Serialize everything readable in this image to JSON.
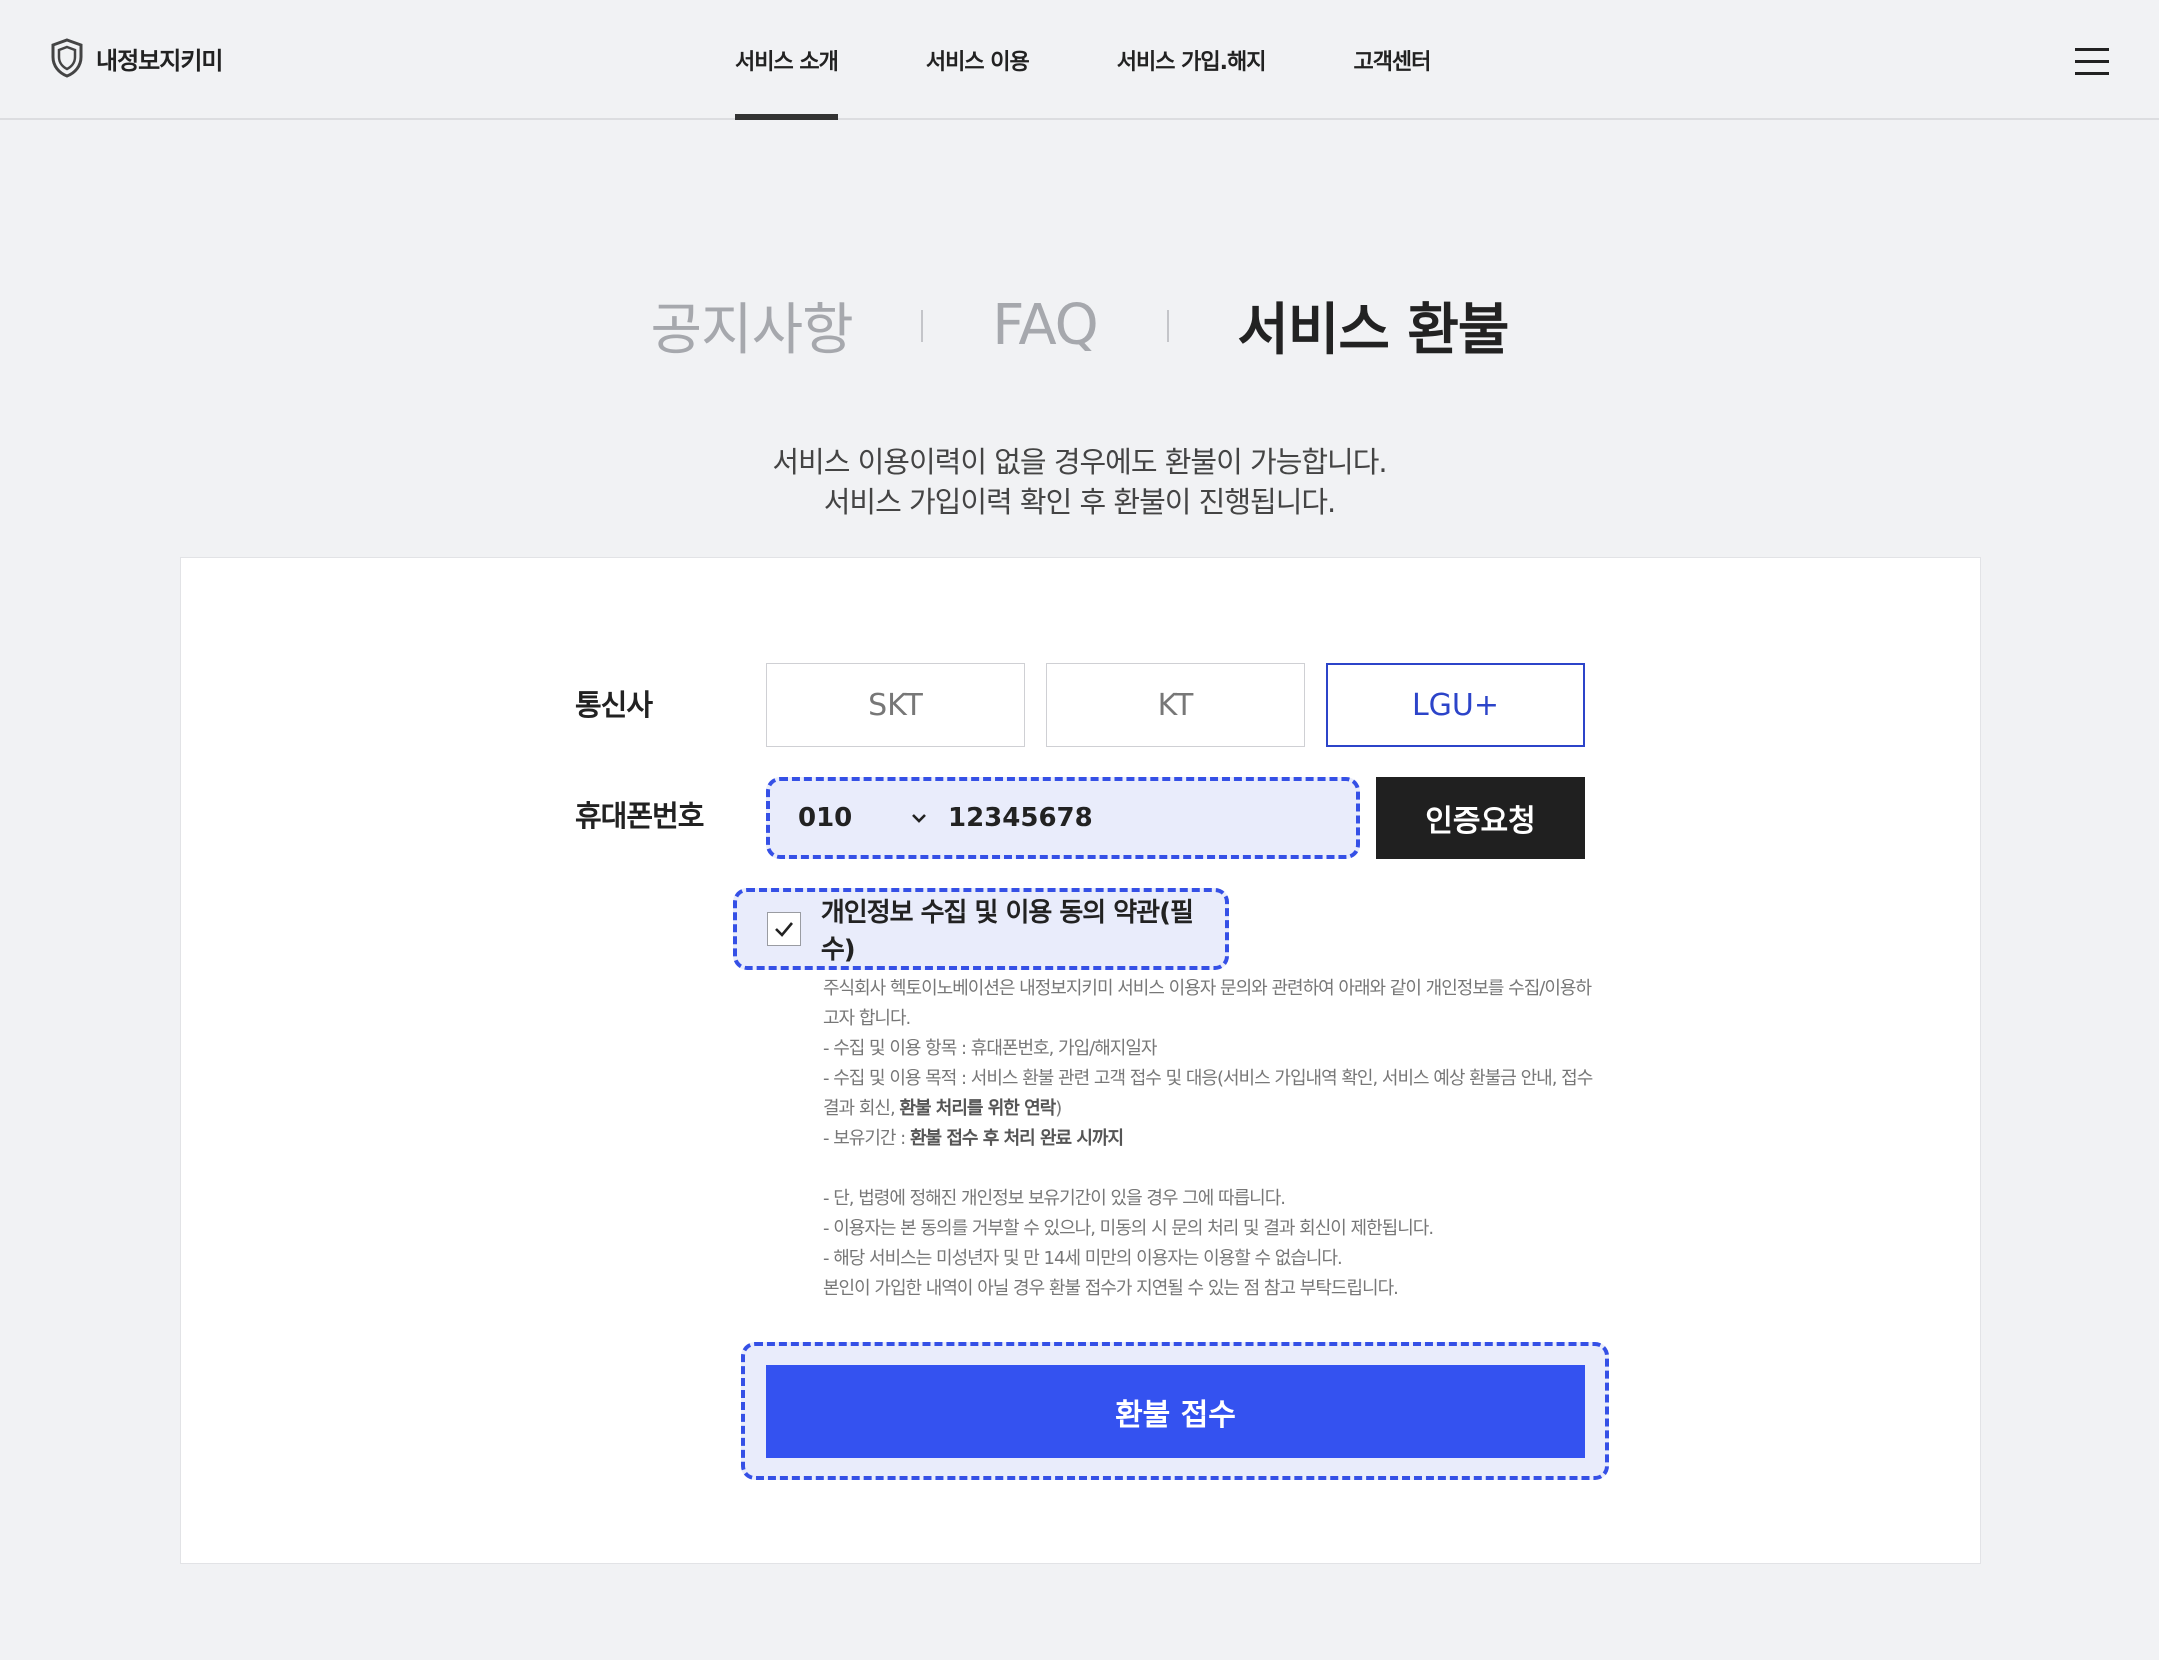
{
  "header": {
    "logo_text": "내정보지키미",
    "nav": [
      "서비스 소개",
      "서비스 이용",
      "서비스 가입.해지",
      "고객센터"
    ],
    "active_nav_index": 0
  },
  "page_tabs": {
    "notice": "공지사항",
    "faq": "FAQ",
    "refund": "서비스 환불"
  },
  "intro": {
    "line1": "서비스 이용이력이 없을 경우에도 환불이 가능합니다.",
    "line2": "서비스 가입이력 확인 후 환불이 진행됩니다."
  },
  "form": {
    "carrier_label": "통신사",
    "carriers": [
      "SKT",
      "KT",
      "LGU+"
    ],
    "selected_carrier": "LGU+",
    "phone_label": "휴대폰번호",
    "phone_prefix": "010",
    "phone_number": "12345678",
    "auth_button": "인증요청",
    "agree_label": "개인정보 수집 및 이용 동의 약관(필수)",
    "agree_checked": true,
    "submit_button": "환불 접수"
  },
  "terms": {
    "p1": "주식회사 헥토이노베이션은 내정보지키미 서비스 이용자 문의와 관련하여 아래와 같이 개인정보를 수집/이용하고자 합니다.",
    "items_label": "- 수집 및 이용 항목 : 휴대폰번호, 가입/해지일자",
    "purpose_prefix": "- 수집 및 이용 목적 : 서비스 환불 관련 고객 접수 및 대응(서비스 가입내역 확인, 서비스 예상 환불금 안내, 접수결과 회신, ",
    "purpose_bold": "환불 처리를 위한 연락",
    "purpose_suffix": ")",
    "retention_prefix": "- 보유기간 : ",
    "retention_bold": "환불 접수 후 처리 완료 시까지",
    "note1": "- 단, 법령에 정해진 개인정보 보유기간이 있을 경우 그에 따릅니다.",
    "note2": "- 이용자는 본 동의를 거부할 수 있으나, 미동의 시 문의 처리 및 결과 회신이 제한됩니다.",
    "note3": "- 해당 서비스는 미성년자 및 만 14세 미만의 이용자는 이용할 수 없습니다.",
    "note4": "본인이 가입한 내역이 아닐 경우 환불 접수가 지연될 수 있는 점 참고 부탁드립니다."
  },
  "colors": {
    "accent": "#3452f0",
    "selected_border": "#2c44c9",
    "highlight_dash": "#3550e6",
    "page_bg": "#f1f2f4"
  }
}
